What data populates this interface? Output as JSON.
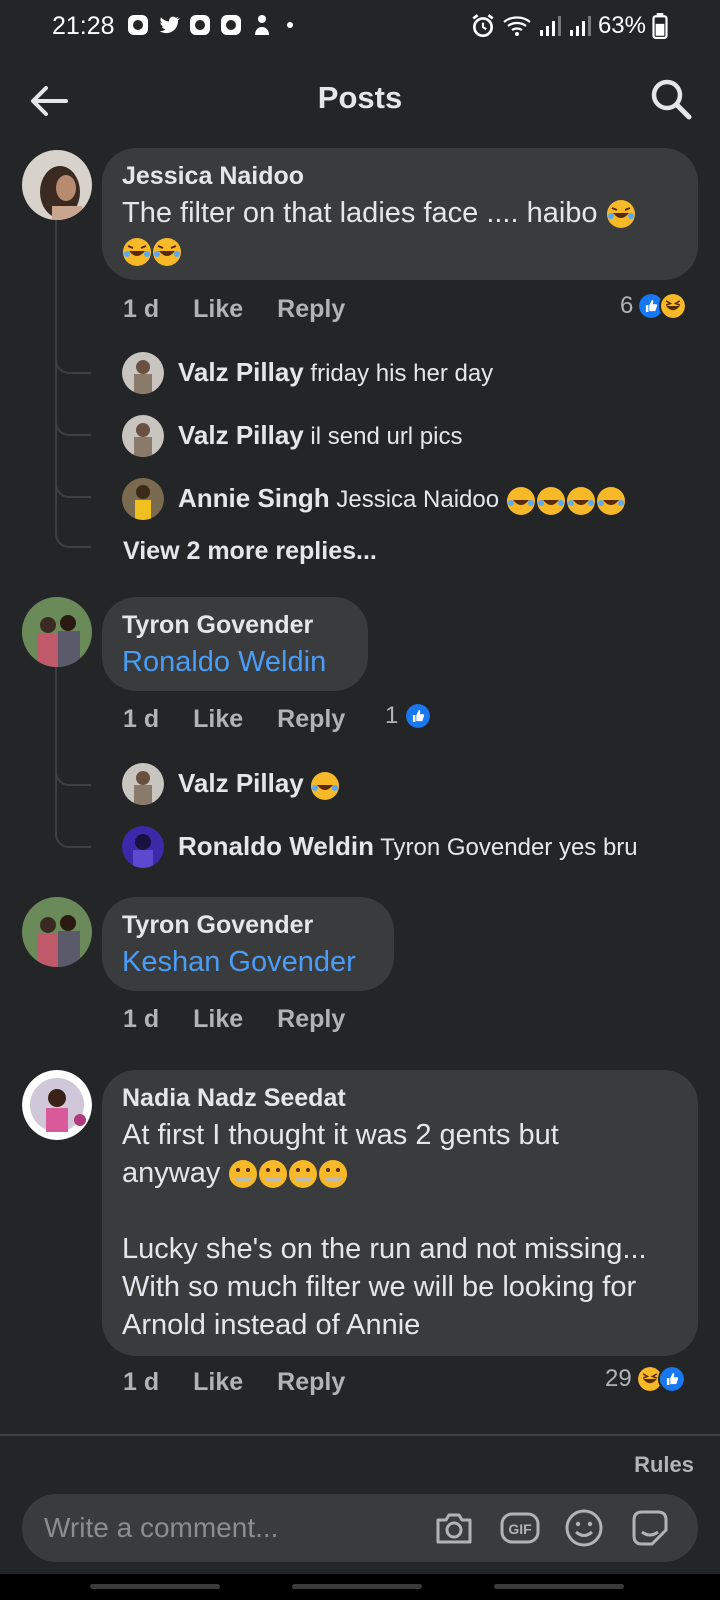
{
  "status_bar": {
    "time": "21:28",
    "battery": "63%"
  },
  "header": {
    "title": "Posts"
  },
  "comments": [
    {
      "name": "Jessica Naidoo",
      "text": "The filter on that ladies face .... haibo",
      "time": "1 d",
      "like": "Like",
      "reply": "Reply",
      "reaction_count": "6",
      "replies": [
        {
          "name": "Valz Pillay",
          "text": "friday his her day"
        },
        {
          "name": "Valz Pillay",
          "text": "il send url pics"
        },
        {
          "name": "Annie Singh",
          "text": "Jessica Naidoo"
        }
      ],
      "view_more": "View 2 more replies..."
    },
    {
      "name": "Tyron Govender",
      "text": "Ronaldo Weldin",
      "time": "1 d",
      "like": "Like",
      "reply": "Reply",
      "reaction_count": "1",
      "replies": [
        {
          "name": "Valz Pillay",
          "text": ""
        },
        {
          "name": "Ronaldo Weldin",
          "text": "Tyron Govender yes bru"
        }
      ]
    },
    {
      "name": "Tyron Govender",
      "text": "Keshan Govender",
      "time": "1 d",
      "like": "Like",
      "reply": "Reply"
    },
    {
      "name": "Nadia Nadz Seedat",
      "text_line1": "At first I thought it was 2 gents but",
      "text_line2": "anyway",
      "text_line3": "Lucky she's on the run and not missing...",
      "text_line4": "With so much filter we will be looking for",
      "text_line5": "Arnold instead of Annie",
      "time": "1 d",
      "like": "Like",
      "reply": "Reply",
      "reaction_count": "29"
    }
  ],
  "composer": {
    "rules": "Rules",
    "placeholder": "Write a comment..."
  },
  "colors": {
    "background": "#242526",
    "bubble": "#3a3b3c",
    "link": "#4a9cf5",
    "like_blue": "#1877f2",
    "haha_yellow": "#f7b928"
  }
}
